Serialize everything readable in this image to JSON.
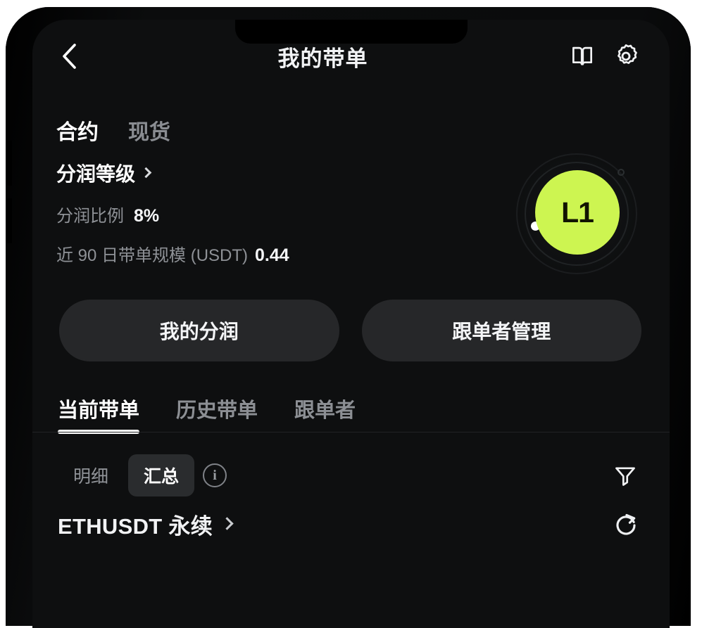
{
  "navbar": {
    "title": "我的带单",
    "back_icon": "chevron-left-icon",
    "book_icon": "book-icon",
    "settings_icon": "gear-icon"
  },
  "market_tabs": [
    {
      "label": "合约",
      "active": true
    },
    {
      "label": "现货",
      "active": false
    }
  ],
  "level_card": {
    "title": "分润等级",
    "chevron_icon": "chevron-right-icon",
    "share_ratio_label": "分润比例",
    "share_ratio_value": "8%",
    "scale_label": "近 90 日带单规模 (USDT)",
    "scale_value": "0.44",
    "badge_label": "L1",
    "badge_color": "#cdf551",
    "badge_text_color": "#111300"
  },
  "actions": {
    "my_profit": "我的分润",
    "follower_management": "跟单者管理"
  },
  "section_tabs": [
    {
      "label": "当前带单",
      "active": true
    },
    {
      "label": "历史带单",
      "active": false
    },
    {
      "label": "跟单者",
      "active": false
    }
  ],
  "filter_row": {
    "detail_label": "明细",
    "summary_label": "汇总",
    "info_icon": "info-circle-icon",
    "info_glyph": "i",
    "filter_icon": "funnel-filter-icon"
  },
  "position": {
    "symbol": "ETHUSDT 永续",
    "chevron_icon": "chevron-right-icon",
    "refresh_icon": "refresh-icon"
  }
}
